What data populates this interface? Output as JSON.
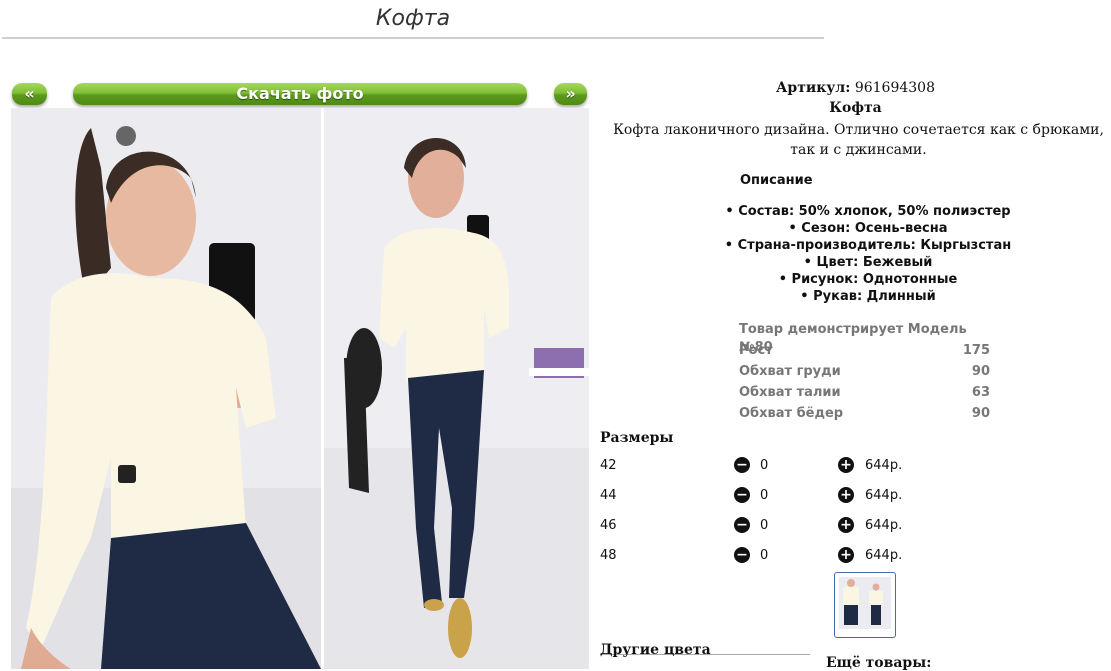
{
  "page": {
    "title": "Кофта"
  },
  "gallery": {
    "prev_label": "«",
    "download_label": "Скачать фото",
    "next_label": "»"
  },
  "product": {
    "article_label": "Артикул:",
    "article_value": "961694308",
    "name": "Кофта",
    "description": "Кофта лаконичного дизайна. Отлично сочетается как с брюками, так и с джинсами."
  },
  "details": {
    "heading": "Описание",
    "features": [
      "Состав: 50% хлопок, 50% полиэстер",
      "Сезон: Осень-весна",
      "Страна-производитель: Кыргызстан",
      "Цвет: Бежевый",
      "Рисунок: Однотонные",
      "Рукав: Длинный"
    ]
  },
  "model": {
    "heading": "Товар демонстрирует Модель №80",
    "rows": [
      {
        "label": "Рост",
        "value": "175"
      },
      {
        "label": "Обхват груди",
        "value": "90"
      },
      {
        "label": "Обхват талии",
        "value": "63"
      },
      {
        "label": "Обхват бёдер",
        "value": "90"
      }
    ]
  },
  "sizes": {
    "title": "Размеры",
    "rows": [
      {
        "size": "42",
        "qty": "0",
        "price": "644р."
      },
      {
        "size": "44",
        "qty": "0",
        "price": "644р."
      },
      {
        "size": "46",
        "qty": "0",
        "price": "644р."
      },
      {
        "size": "48",
        "qty": "0",
        "price": "644р."
      }
    ]
  },
  "footer": {
    "other_colors": "Другие цвета",
    "more_goods": "Ещё товары:"
  },
  "colors": {
    "green_button": "#6fb02a",
    "sweater": "#fbf5e3",
    "jeans": "#1f2a45"
  }
}
